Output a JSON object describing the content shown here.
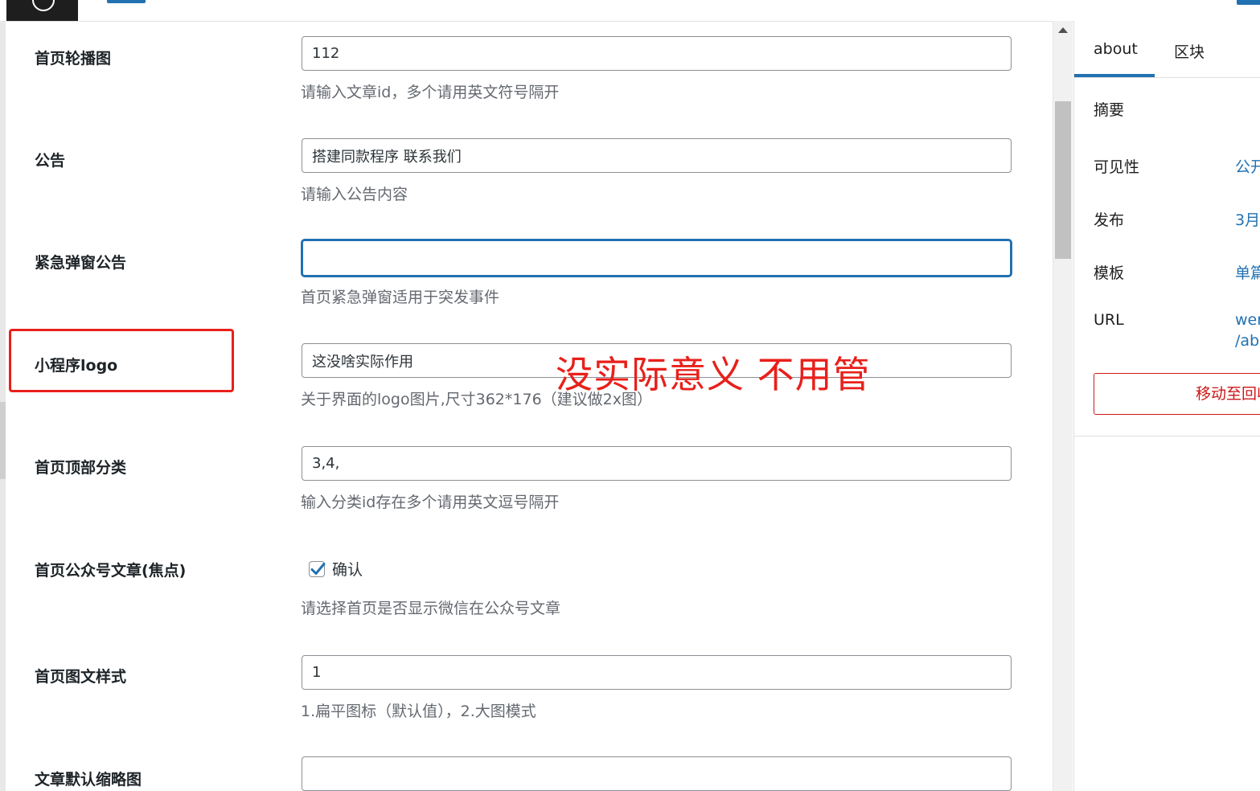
{
  "form": {
    "rows": [
      {
        "label": "首页轮播图",
        "value": "112",
        "placeholder": "",
        "desc": "请输入文章id，多个请用英文符号隔开"
      },
      {
        "label": "公告",
        "value": "搭建同款程序 联系我们",
        "placeholder": "",
        "desc": "请输入公告内容"
      },
      {
        "label": "紧急弹窗公告",
        "value": "",
        "placeholder": "",
        "desc": "首页紧急弹窗适用于突发事件"
      },
      {
        "label": "小程序logo",
        "value": "这没啥实际作用",
        "placeholder": "",
        "desc": "关于界面的logo图片,尺寸362*176（建议做2x图）"
      },
      {
        "label": "首页顶部分类",
        "value": "3,4,",
        "placeholder": "",
        "desc": "输入分类id存在多个请用英文逗号隔开"
      },
      {
        "label": "首页公众号文章(焦点)",
        "checkbox_label": "确认",
        "checked": true,
        "desc": "请选择首页是否显示微信在公众号文章"
      },
      {
        "label": "首页图文样式",
        "value": "1",
        "placeholder": "",
        "desc": "1.扁平图标（默认值），2.大图模式"
      },
      {
        "label": "文章默认缩略图",
        "value": "",
        "placeholder": ""
      }
    ]
  },
  "annotation": {
    "text": "没实际意义 不用管",
    "color": "#e8201b"
  },
  "sidebar": {
    "tabs": [
      "about",
      "区块"
    ],
    "active_tab": "about",
    "items": [
      {
        "label": "摘要",
        "value": ""
      },
      {
        "label": "可见性",
        "value": "公开"
      },
      {
        "label": "发布",
        "value": "3月"
      },
      {
        "label": "模板",
        "value": "单篇"
      },
      {
        "label": "URL",
        "value": "wen",
        "value2": "/abo"
      }
    ],
    "trash_button": "移动至回收站"
  },
  "colors": {
    "accent": "#2271b1",
    "danger": "#cc1818",
    "annotation": "#e8201b"
  }
}
